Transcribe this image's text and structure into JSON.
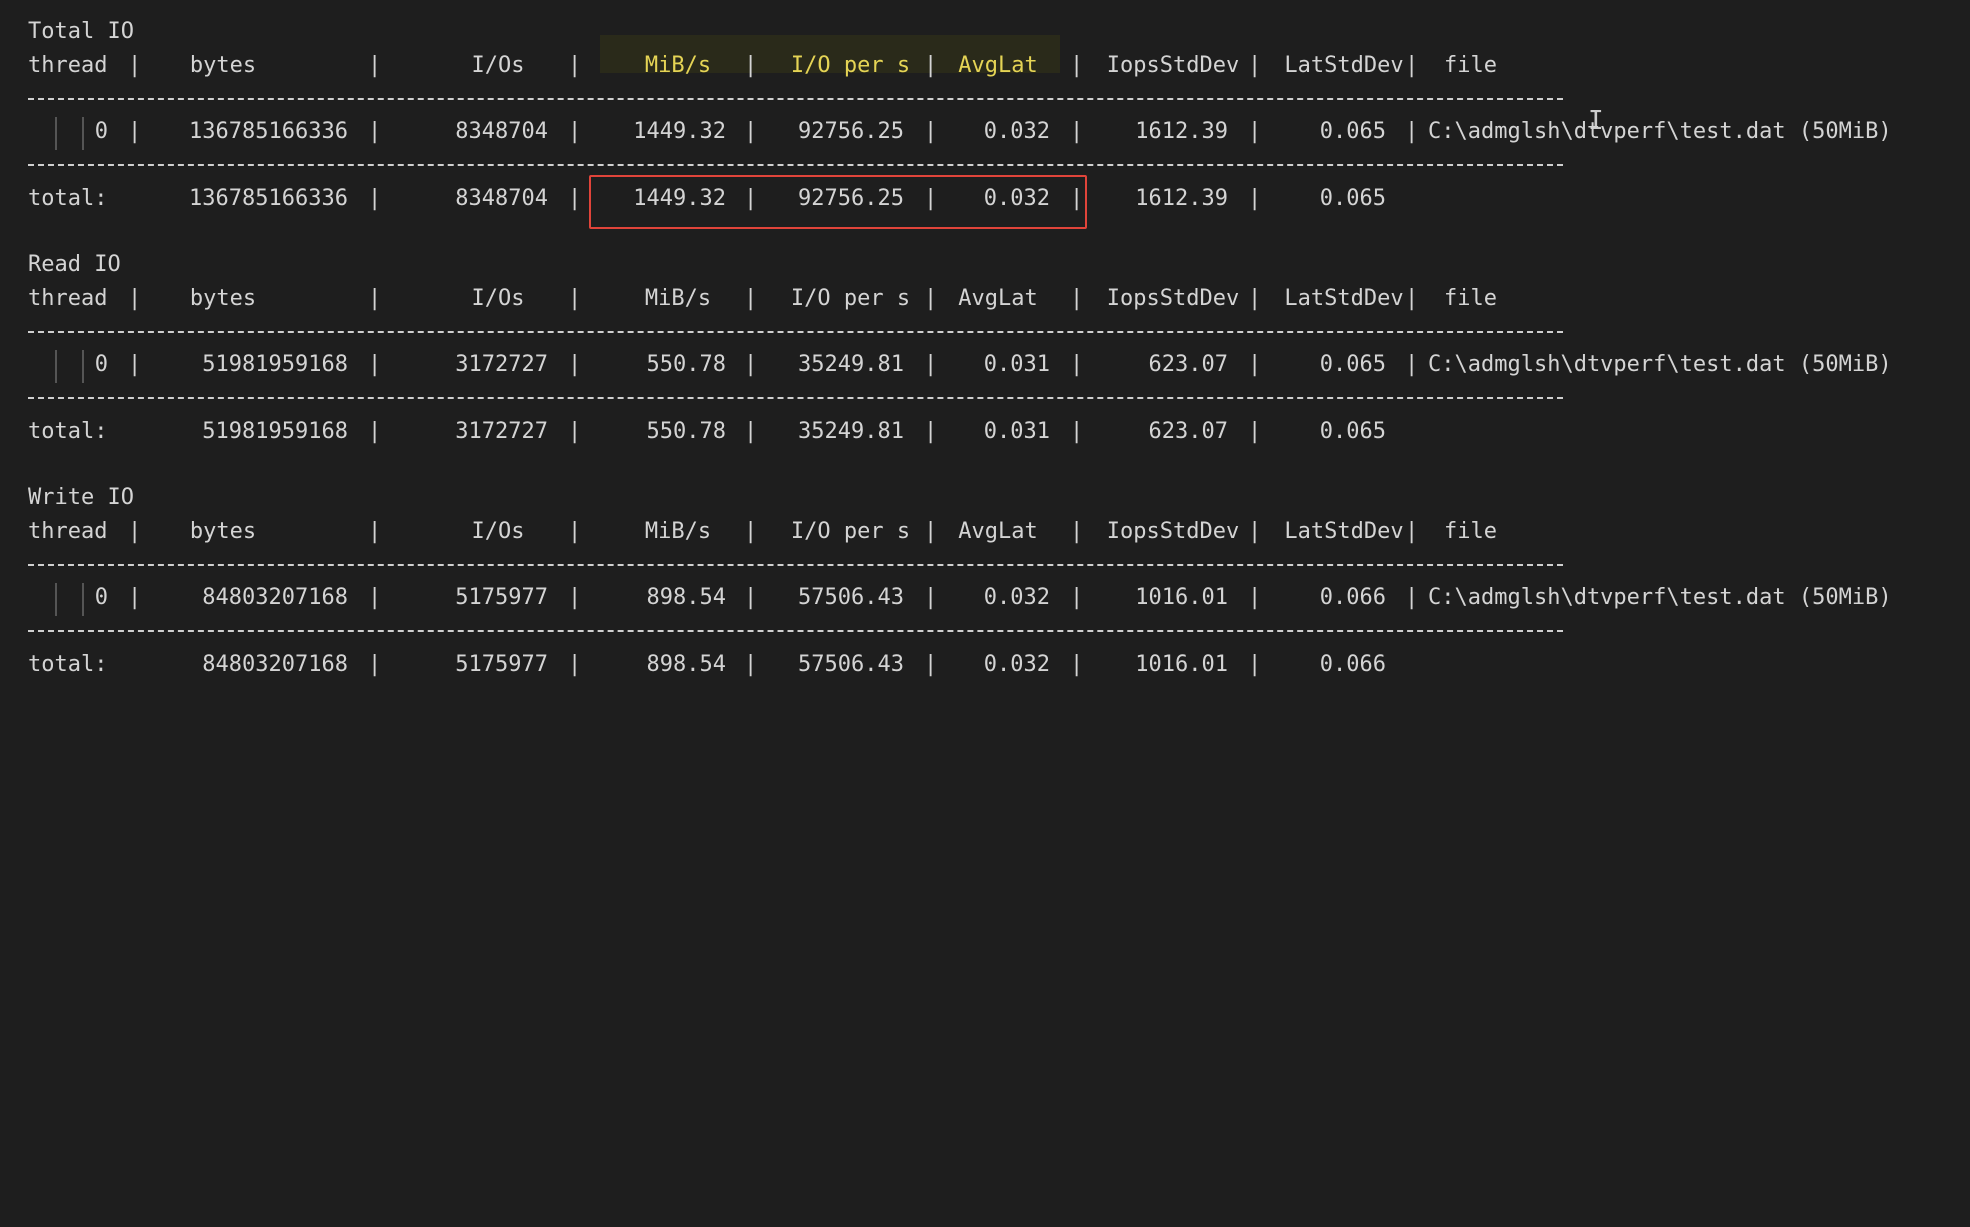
{
  "sections": [
    {
      "title": "Total IO",
      "header": [
        "thread",
        "bytes",
        "I/Os",
        "MiB/s",
        "I/O per s",
        "AvgLat",
        "IopsStdDev",
        "LatStdDev",
        "file"
      ],
      "row": {
        "thread": "0",
        "bytes": "136785166336",
        "ios": "8348704",
        "mibs": "1449.32",
        "iops": "92756.25",
        "avglat": "0.032",
        "iopsstd": "1612.39",
        "latstd": "0.065",
        "file": "C:\\admglsh\\dtvperf\\test.dat (50MiB)"
      },
      "total": {
        "label": "total:",
        "bytes": "136785166336",
        "ios": "8348704",
        "mibs": "1449.32",
        "iops": "92756.25",
        "avglat": "0.032",
        "iopsstd": "1612.39",
        "latstd": "0.065"
      }
    },
    {
      "title": "Read IO",
      "header": [
        "thread",
        "bytes",
        "I/Os",
        "MiB/s",
        "I/O per s",
        "AvgLat",
        "IopsStdDev",
        "LatStdDev",
        "file"
      ],
      "row": {
        "thread": "0",
        "bytes": "51981959168",
        "ios": "3172727",
        "mibs": "550.78",
        "iops": "35249.81",
        "avglat": "0.031",
        "iopsstd": "623.07",
        "latstd": "0.065",
        "file": "C:\\admglsh\\dtvperf\\test.dat (50MiB)"
      },
      "total": {
        "label": "total:",
        "bytes": "51981959168",
        "ios": "3172727",
        "mibs": "550.78",
        "iops": "35249.81",
        "avglat": "0.031",
        "iopsstd": "623.07",
        "latstd": "0.065"
      }
    },
    {
      "title": "Write IO",
      "header": [
        "thread",
        "bytes",
        "I/Os",
        "MiB/s",
        "I/O per s",
        "AvgLat",
        "IopsStdDev",
        "LatStdDev",
        "file"
      ],
      "row": {
        "thread": "0",
        "bytes": "84803207168",
        "ios": "5175977",
        "mibs": "898.54",
        "iops": "57506.43",
        "avglat": "0.032",
        "iopsstd": "1016.01",
        "latstd": "0.066",
        "file": "C:\\admglsh\\dtvperf\\test.dat (50MiB)"
      },
      "total": {
        "label": "total:",
        "bytes": "84803207168",
        "ios": "5175977",
        "mibs": "898.54",
        "iops": "57506.43",
        "avglat": "0.032",
        "iopsstd": "1016.01",
        "latstd": "0.066"
      }
    }
  ],
  "separator_char": "|",
  "colors": {
    "background": "#1e1e1e",
    "text": "#d4d4d4",
    "highlight_text": "#e5d455",
    "highlight_box": "#e0443a"
  },
  "cursor_icon": "text-cursor-icon"
}
